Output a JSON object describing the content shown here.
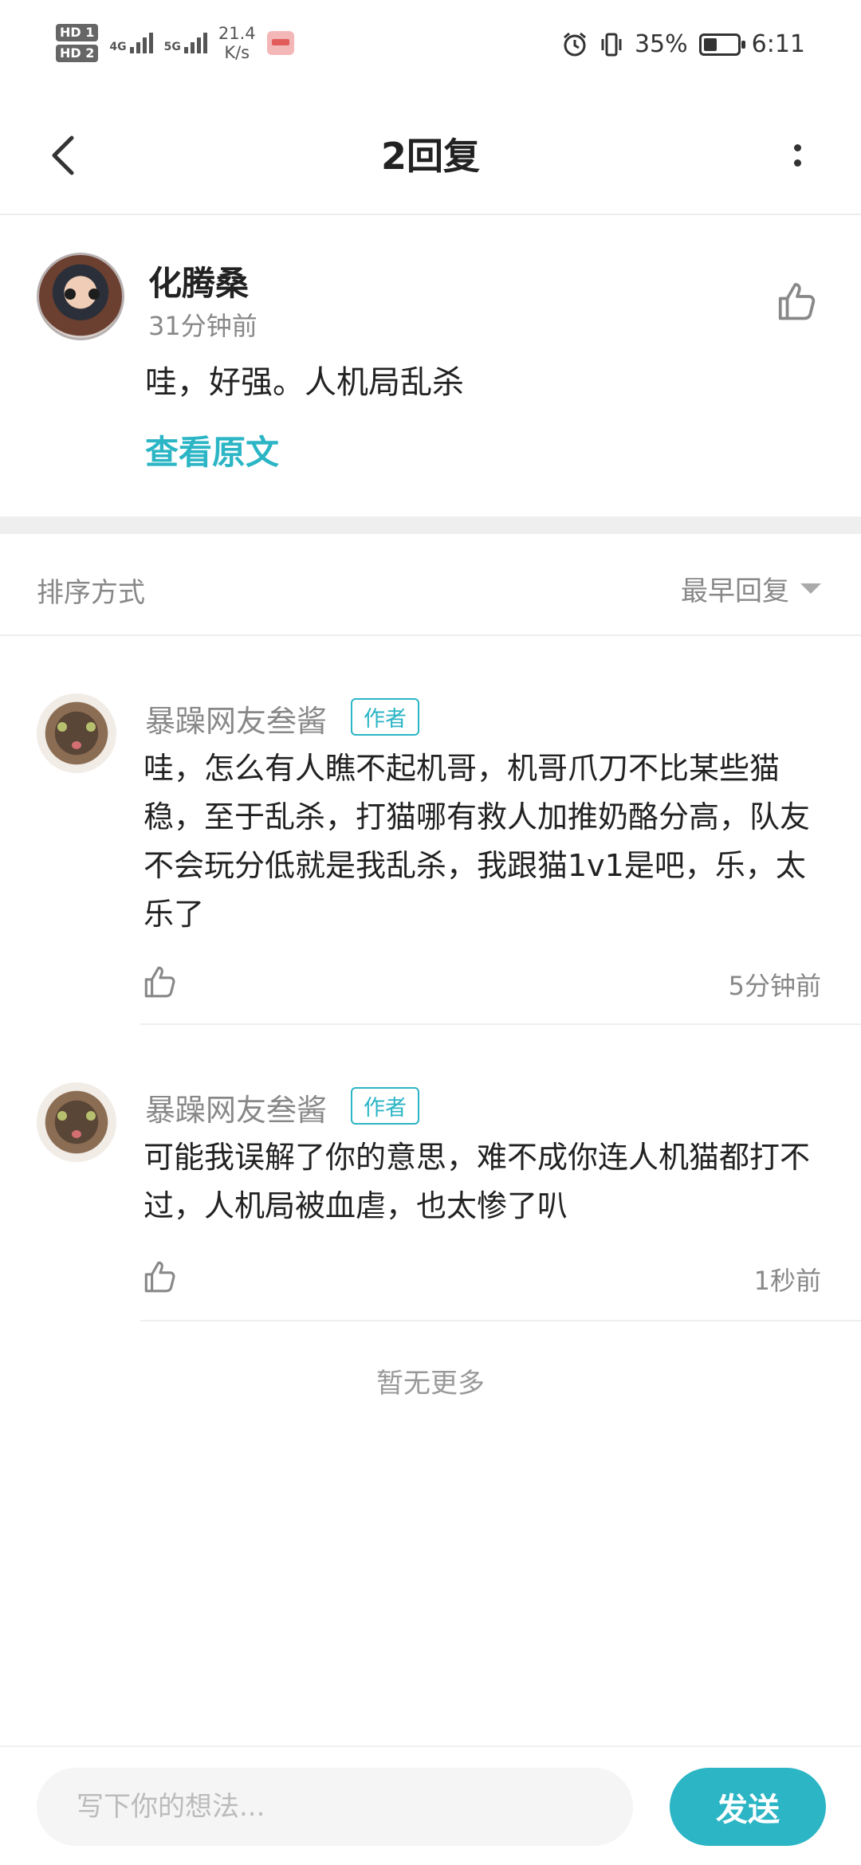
{
  "status_bar": {
    "hd1": "HD 1",
    "hd2": "HD 2",
    "net1": "4G",
    "net2": "5G",
    "speed_value": "21.4",
    "speed_unit": "K/s",
    "battery": "35%",
    "time": "6:11"
  },
  "header": {
    "title": "2回复"
  },
  "original": {
    "author": "化腾桑",
    "time": "31分钟前",
    "text": "哇，好强。人机局乱杀",
    "view_original": "查看原文"
  },
  "sort": {
    "label": "排序方式",
    "selected": "最早回复"
  },
  "replies": [
    {
      "author": "暴躁网友叁酱",
      "badge": "作者",
      "text": "哇，怎么有人瞧不起机哥，机哥爪刀不比某些猫稳，至于乱杀，打猫哪有救人加推奶酪分高，队友不会玩分低就是我乱杀，我跟猫1v1是吧，乐，太乐了",
      "time": "5分钟前"
    },
    {
      "author": "暴躁网友叁酱",
      "badge": "作者",
      "text": "可能我误解了你的意思，难不成你连人机猫都打不过，人机局被血虐，也太惨了叭",
      "time": "1秒前"
    }
  ],
  "footer_note": "暂无更多",
  "composer": {
    "placeholder": "写下你的想法...",
    "send_label": "发送"
  },
  "colors": {
    "accent": "#2bb5c5",
    "secondary_text": "#888888"
  }
}
